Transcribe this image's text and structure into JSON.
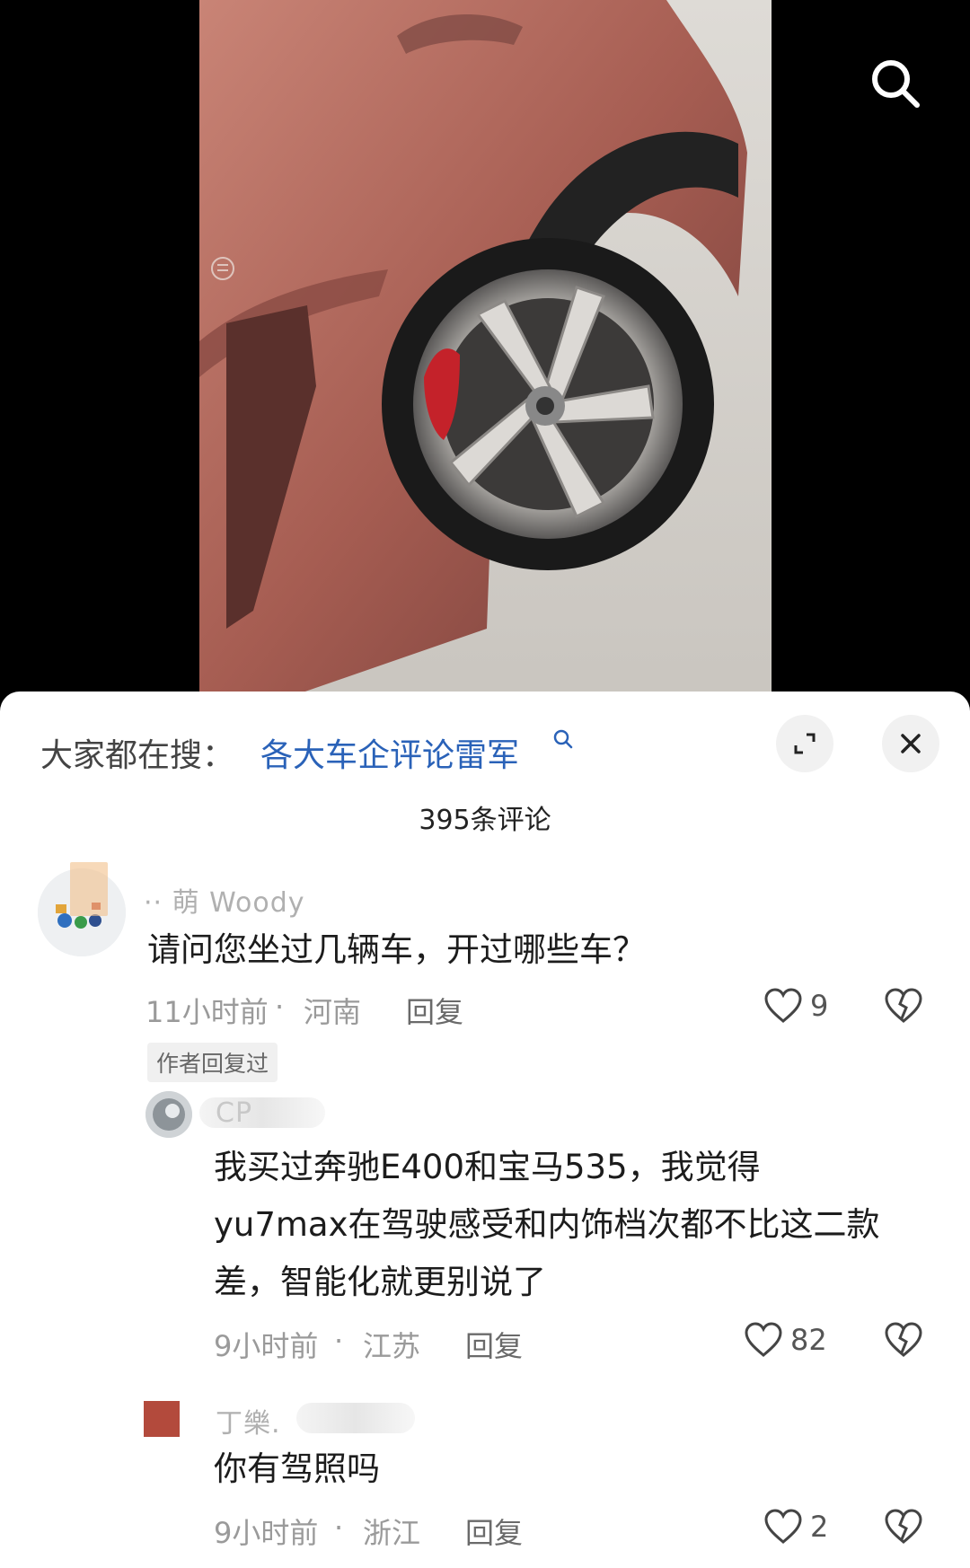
{
  "search_bar": {
    "prefix": "大家都在搜：",
    "query": "各大车企评论雷军"
  },
  "comment_count": "395条评论",
  "comments": [
    {
      "username": "·· 萌 Woody",
      "text": "请问您坐过几辆车，开过哪些车？",
      "time": "11小时前",
      "location": "河南",
      "reply_label": "回复",
      "likes": "9",
      "badge": "作者回复过"
    },
    {
      "username": "CP",
      "text_lines": [
        "我买过奔驰E400和宝马535，我觉得",
        "yu7max在驾驶感受和内饰档次都不比这二款",
        "差，智能化就更别说了"
      ],
      "time": "9小时前",
      "location": "江苏",
      "reply_label": "回复",
      "likes": "82"
    },
    {
      "username": "丁樂.",
      "text": "你有驾照吗",
      "time": "9小时前",
      "location": "浙江",
      "reply_label": "回复",
      "likes": "2"
    }
  ],
  "colors": {
    "link": "#2a62b8",
    "text": "#1c1c1c",
    "meta": "#9a9a9a"
  }
}
